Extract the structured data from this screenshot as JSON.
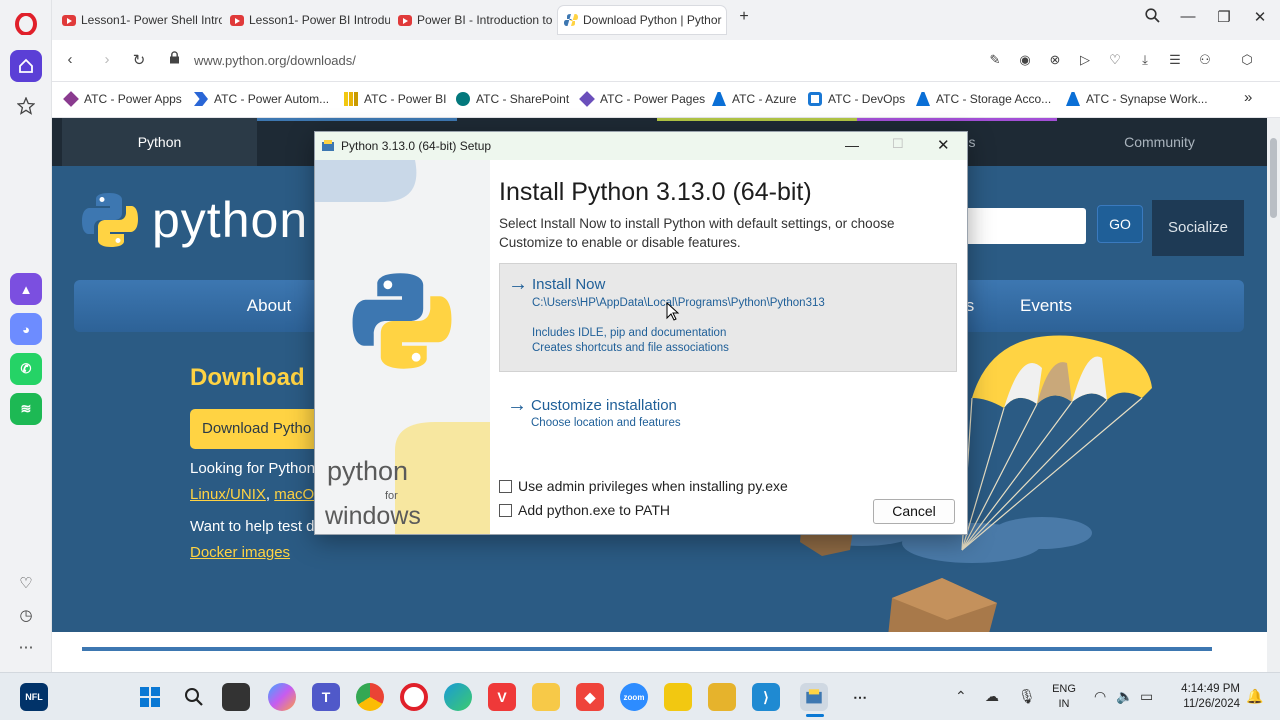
{
  "browser": {
    "tabs": [
      {
        "label": "Lesson1- Power Shell Intro",
        "active": false
      },
      {
        "label": "Lesson1- Power BI Introdu",
        "active": false
      },
      {
        "label": "Power BI - Introduction to",
        "active": false
      },
      {
        "label": "Download Python | Pythor",
        "active": true
      }
    ],
    "new_tab": "+",
    "url": "www.python.org/downloads/",
    "bookmarks": [
      "ATC - Power Apps",
      "ATC - Power Autom...",
      "ATC - Power BI",
      "ATC - SharePoint",
      "ATC - Power Pages",
      "ATC - Azure",
      "ATC - DevOps",
      "ATC - Storage Acco...",
      "ATC - Synapse Work..."
    ],
    "bookmarks_more": "»"
  },
  "site": {
    "topnav": {
      "python": "Python",
      "community": "Community",
      "hidden_item": "s"
    },
    "logo_text": "python",
    "go_label": "GO",
    "socialize_label": "Socialize",
    "mainnav": {
      "about": "About",
      "partial": "s",
      "events": "Events"
    },
    "download_heading": "Download",
    "download_button": "Download Pytho",
    "looking_for": "Looking for Python",
    "linux_link": "Linux/UNIX",
    "comma": ",",
    "macos_link": "macO",
    "want_to_help": "Want to help test d",
    "docker_link": "Docker images"
  },
  "dialog": {
    "title": "Python 3.13.0 (64-bit) Setup",
    "heading": "Install Python 3.13.0 (64-bit)",
    "description": "Select Install Now to install Python with default settings, or choose Customize to enable or disable features.",
    "install_now": {
      "label": "Install Now",
      "path": "C:\\Users\\HP\\AppData\\Local\\Programs\\Python\\Python313",
      "line1": "Includes IDLE, pip and documentation",
      "line2": "Creates shortcuts and file associations"
    },
    "customize": {
      "label": "Customize installation",
      "sub": "Choose location and features"
    },
    "checkbox_admin": "Use admin privileges when installing py.exe",
    "checkbox_path": "Add python.exe to PATH",
    "cancel": "Cancel",
    "side_text_python": "python",
    "side_text_for": "for",
    "side_text_windows": "windows"
  },
  "taskbar": {
    "lang_line1": "ENG",
    "lang_line2": "IN",
    "time": "4:14:49 PM",
    "date": "11/26/2024"
  },
  "colors": {
    "python_blue": "#2b5b84",
    "python_yellow": "#ffd343",
    "link_blue": "#1f5f98",
    "opera_red": "#e0202a"
  }
}
